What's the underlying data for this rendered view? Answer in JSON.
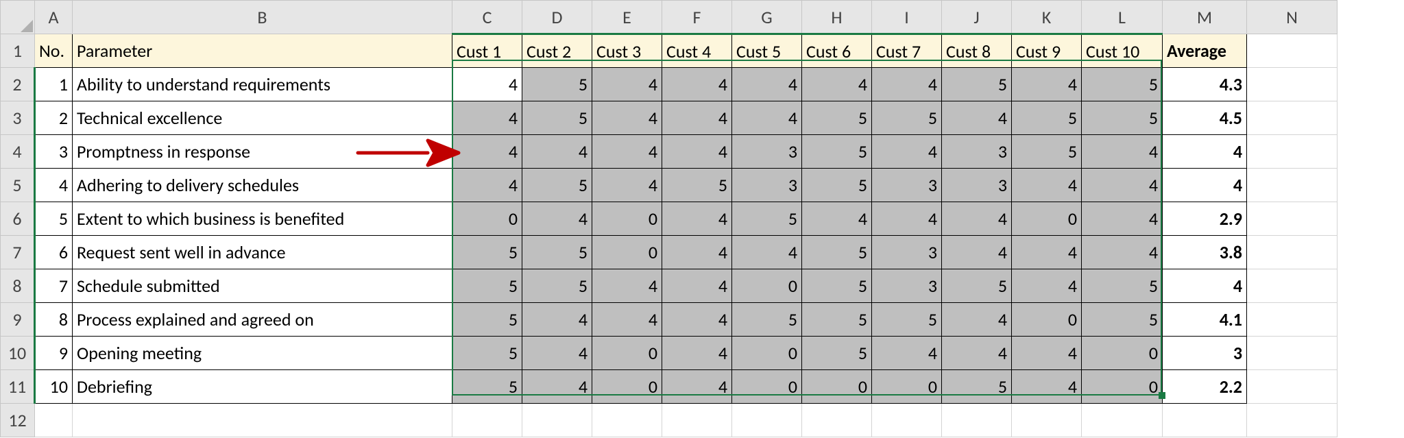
{
  "columns": {
    "letters": [
      "A",
      "B",
      "C",
      "D",
      "E",
      "F",
      "G",
      "H",
      "I",
      "J",
      "K",
      "L",
      "M",
      "N"
    ],
    "widths": [
      55,
      554,
      102,
      102,
      102,
      102,
      102,
      102,
      102,
      102,
      102,
      118,
      123,
      132
    ]
  },
  "rowNumbers": [
    "1",
    "2",
    "3",
    "4",
    "5",
    "6",
    "7",
    "8",
    "9",
    "10",
    "11",
    "12"
  ],
  "header": {
    "no": "No.",
    "param": "Parameter",
    "cust": [
      "Cust 1",
      "Cust 2",
      "Cust 3",
      "Cust 4",
      "Cust 5",
      "Cust 6",
      "Cust 7",
      "Cust 8",
      "Cust 9",
      "Cust 10"
    ],
    "avg": "Average"
  },
  "rows": [
    {
      "no": "1",
      "param": "Ability to understand requirements",
      "v": [
        4,
        5,
        4,
        4,
        4,
        4,
        4,
        5,
        4,
        5
      ],
      "avg": "4.3"
    },
    {
      "no": "2",
      "param": "Technical excellence",
      "v": [
        4,
        5,
        4,
        4,
        4,
        5,
        5,
        4,
        5,
        5
      ],
      "avg": "4.5"
    },
    {
      "no": "3",
      "param": "Promptness in response",
      "v": [
        4,
        4,
        4,
        4,
        3,
        5,
        4,
        3,
        5,
        4
      ],
      "avg": "4"
    },
    {
      "no": "4",
      "param": "Adhering to delivery schedules",
      "v": [
        4,
        5,
        4,
        5,
        3,
        5,
        3,
        3,
        4,
        4
      ],
      "avg": "4"
    },
    {
      "no": "5",
      "param": "Extent to which business is benefited",
      "v": [
        0,
        4,
        0,
        4,
        5,
        4,
        4,
        4,
        0,
        4
      ],
      "avg": "2.9"
    },
    {
      "no": "6",
      "param": "Request sent well in advance",
      "v": [
        5,
        5,
        0,
        4,
        4,
        5,
        3,
        4,
        4,
        4
      ],
      "avg": "3.8"
    },
    {
      "no": "7",
      "param": "Schedule submitted",
      "v": [
        5,
        5,
        4,
        4,
        0,
        5,
        3,
        5,
        4,
        5
      ],
      "avg": "4"
    },
    {
      "no": "8",
      "param": "Process explained and agreed on",
      "v": [
        5,
        4,
        4,
        4,
        5,
        5,
        5,
        4,
        0,
        5
      ],
      "avg": "4.1"
    },
    {
      "no": "9",
      "param": "Opening meeting",
      "v": [
        5,
        4,
        0,
        4,
        0,
        5,
        4,
        4,
        4,
        0
      ],
      "avg": "3"
    },
    {
      "no": "10",
      "param": "Debriefing",
      "v": [
        5,
        4,
        0,
        4,
        0,
        0,
        0,
        5,
        4,
        0
      ],
      "avg": "2.2"
    }
  ],
  "selection": {
    "c1": "C",
    "r1": 2,
    "c2": "L",
    "r2": 11
  },
  "chart_data": {
    "type": "table",
    "columns": [
      "No.",
      "Parameter",
      "Cust 1",
      "Cust 2",
      "Cust 3",
      "Cust 4",
      "Cust 5",
      "Cust 6",
      "Cust 7",
      "Cust 8",
      "Cust 9",
      "Cust 10",
      "Average"
    ],
    "rows": [
      [
        1,
        "Ability to understand requirements",
        4,
        5,
        4,
        4,
        4,
        4,
        4,
        5,
        4,
        5,
        4.3
      ],
      [
        2,
        "Technical excellence",
        4,
        5,
        4,
        4,
        4,
        5,
        5,
        4,
        5,
        5,
        4.5
      ],
      [
        3,
        "Promptness in response",
        4,
        4,
        4,
        4,
        3,
        5,
        4,
        3,
        5,
        4,
        4
      ],
      [
        4,
        "Adhering to delivery schedules",
        4,
        5,
        4,
        5,
        3,
        5,
        3,
        3,
        4,
        4,
        4
      ],
      [
        5,
        "Extent to which business is benefited",
        0,
        4,
        0,
        4,
        5,
        4,
        4,
        4,
        0,
        4,
        2.9
      ],
      [
        6,
        "Request sent well in advance",
        5,
        5,
        0,
        4,
        4,
        5,
        3,
        4,
        4,
        4,
        3.8
      ],
      [
        7,
        "Schedule submitted",
        5,
        5,
        4,
        4,
        0,
        5,
        3,
        5,
        4,
        5,
        4
      ],
      [
        8,
        "Process explained and agreed on",
        5,
        4,
        4,
        4,
        5,
        5,
        5,
        4,
        0,
        5,
        4.1
      ],
      [
        9,
        "Opening meeting",
        5,
        4,
        0,
        4,
        0,
        5,
        4,
        4,
        4,
        0,
        3
      ],
      [
        10,
        "Debriefing",
        5,
        4,
        0,
        4,
        0,
        0,
        0,
        5,
        4,
        0,
        2.2
      ]
    ]
  }
}
